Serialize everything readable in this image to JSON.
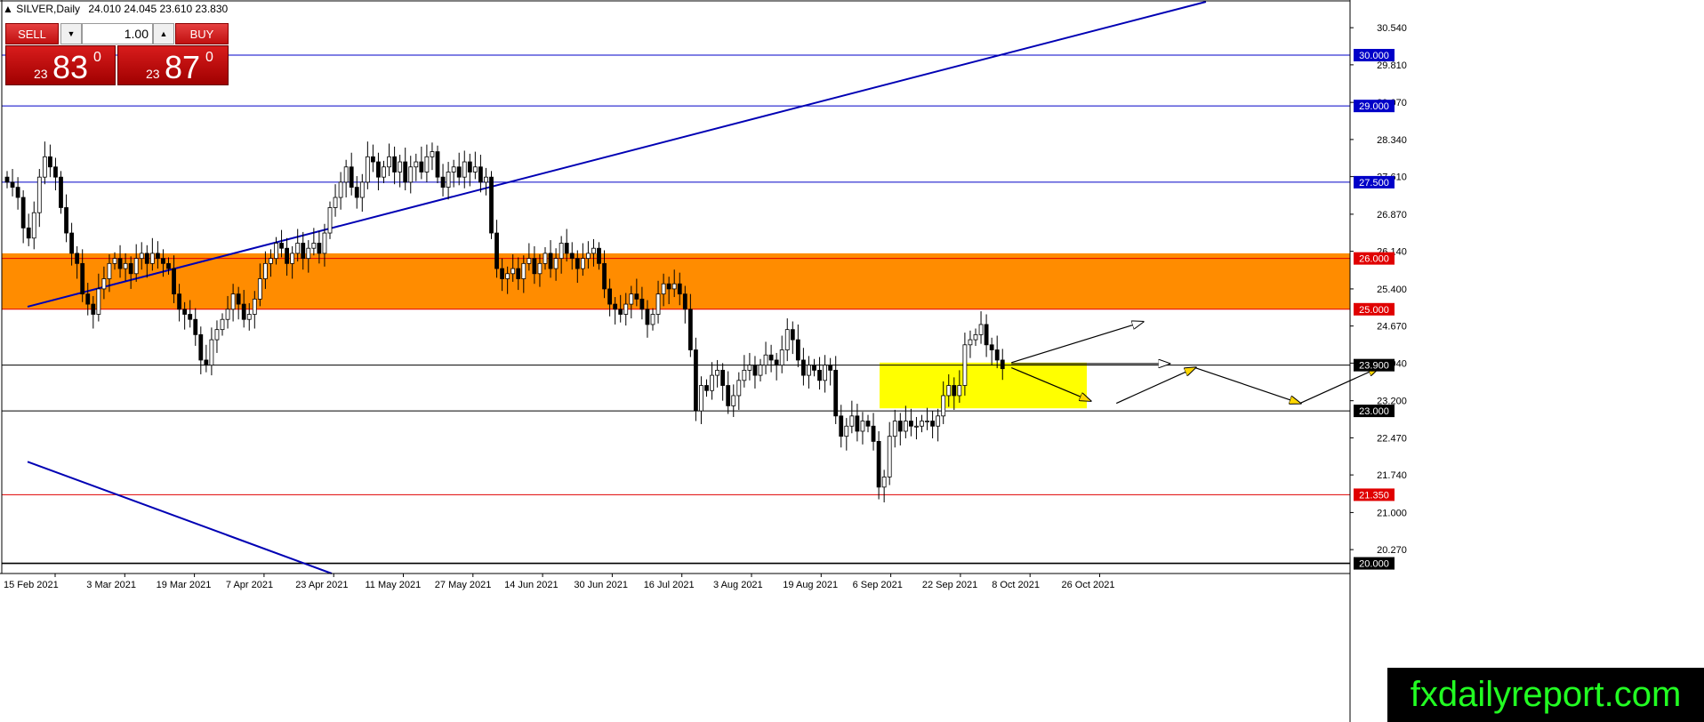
{
  "header": {
    "symbol": "SILVER,Daily",
    "ohlc": "24.010 24.045 23.610 23.830"
  },
  "trade_panel": {
    "sell_label": "SELL",
    "buy_label": "BUY",
    "lot_value": "1.00",
    "sell_price": {
      "prefix": "23",
      "big": "83",
      "sup": "0"
    },
    "buy_price": {
      "prefix": "23",
      "big": "87",
      "sup": "0"
    }
  },
  "watermark": "fxdailyreport.com",
  "colors": {
    "resistance_zone": "#ff8c00",
    "consolidation_zone": "#ffff00",
    "trendline": "#0000b4",
    "level_blue": "#0000c8",
    "level_red": "#e00000",
    "level_black": "#000000",
    "arrow_fill": "#ffd700",
    "watermark_bg": "#000000",
    "watermark_text": "#22ff22",
    "button_red": "#c81414"
  },
  "chart_data": {
    "type": "candlestick",
    "symbol": "SILVER",
    "timeframe": "Daily",
    "ylim": [
      19.8,
      31.05
    ],
    "price_ticks": [
      "30.540",
      "29.810",
      "29.070",
      "28.340",
      "27.610",
      "26.870",
      "26.140",
      "25.400",
      "24.670",
      "23.940",
      "23.200",
      "22.470",
      "21.740",
      "21.000",
      "20.270"
    ],
    "date_ticks": [
      "15 Feb 2021",
      "3 Mar 2021",
      "19 Mar 2021",
      "7 Apr 2021",
      "23 Apr 2021",
      "11 May 2021",
      "27 May 2021",
      "14 Jun 2021",
      "30 Jun 2021",
      "16 Jul 2021",
      "3 Aug 2021",
      "19 Aug 2021",
      "6 Sep 2021",
      "22 Sep 2021",
      "8 Oct 2021",
      "26 Oct 2021"
    ],
    "horizontal_levels": [
      {
        "price": 30.0,
        "label": "30.000",
        "color": "blue"
      },
      {
        "price": 29.0,
        "label": "29.000",
        "color": "blue"
      },
      {
        "price": 27.5,
        "label": "27.500",
        "color": "blue"
      },
      {
        "price": 26.0,
        "label": "26.000",
        "color": "red"
      },
      {
        "price": 25.0,
        "label": "25.000",
        "color": "red"
      },
      {
        "price": 23.9,
        "label": "23.900",
        "color": "black"
      },
      {
        "price": 23.0,
        "label": "23.000",
        "color": "black"
      },
      {
        "price": 21.35,
        "label": "21.350",
        "color": "red"
      },
      {
        "price": 20.0,
        "label": "20.000",
        "color": "black"
      }
    ],
    "zones": [
      {
        "name": "resistance",
        "from_date": "15 Feb 2021",
        "to_date": "open",
        "low": 25.0,
        "high": 26.1
      },
      {
        "name": "consolidation",
        "from_date": "3 Aug 2021",
        "to_date": "13 Sep 2021",
        "low": 23.05,
        "high": 23.95
      }
    ],
    "trendlines": [
      {
        "from": [
          "15 Feb 2021",
          25.05
        ],
        "to": [
          "3 Nov 2021",
          31.05
        ]
      },
      {
        "from": [
          "15 Feb 2021",
          22.0
        ],
        "to": [
          "23 Apr 2021",
          19.8
        ]
      }
    ],
    "projection_arrows": [
      {
        "from": [
          23.95,
          0
        ],
        "to": [
          24.75,
          5
        ],
        "fill": false
      },
      {
        "from": [
          23.93,
          0
        ],
        "to": [
          23.93,
          6
        ],
        "fill": false
      },
      {
        "from": [
          23.85,
          0
        ],
        "to": [
          23.2,
          3
        ],
        "fill": true
      },
      {
        "from": [
          23.15,
          4
        ],
        "to": [
          23.85,
          7
        ],
        "fill": true
      },
      {
        "from": [
          23.85,
          7
        ],
        "to": [
          23.15,
          11
        ],
        "fill": true
      },
      {
        "from": [
          23.15,
          11
        ],
        "to": [
          23.85,
          14
        ],
        "fill": true
      }
    ],
    "closes": [
      27.5,
      27.4,
      27.2,
      26.6,
      26.4,
      26.9,
      27.6,
      28.0,
      27.8,
      27.6,
      27.0,
      26.5,
      26.1,
      25.9,
      25.3,
      25.1,
      24.9,
      25.4,
      25.6,
      25.9,
      26.0,
      25.8,
      25.9,
      25.7,
      26.0,
      26.1,
      25.9,
      26.1,
      26.0,
      25.9,
      25.8,
      25.3,
      25.0,
      24.9,
      24.8,
      24.5,
      24.0,
      23.9,
      24.4,
      24.6,
      24.8,
      25.0,
      25.3,
      25.1,
      24.8,
      24.9,
      25.2,
      25.6,
      25.9,
      26.0,
      26.3,
      26.2,
      25.9,
      26.1,
      26.3,
      26.0,
      26.2,
      26.3,
      26.1,
      26.5,
      27.0,
      27.2,
      27.5,
      27.8,
      27.4,
      27.2,
      27.5,
      28.0,
      27.9,
      27.6,
      27.8,
      28.0,
      27.7,
      27.9,
      27.5,
      27.8,
      27.9,
      27.7,
      28.0,
      28.1,
      27.6,
      27.4,
      27.7,
      27.8,
      27.6,
      27.9,
      27.7,
      27.8,
      27.5,
      27.6,
      26.5,
      25.8,
      25.6,
      25.7,
      25.8,
      25.6,
      25.9,
      26.0,
      25.7,
      25.9,
      26.1,
      25.8,
      26.0,
      26.3,
      26.1,
      26.0,
      25.8,
      26.0,
      26.1,
      26.2,
      25.9,
      25.4,
      25.1,
      25.0,
      24.9,
      25.1,
      25.3,
      25.2,
      25.0,
      24.7,
      24.9,
      25.3,
      25.5,
      25.4,
      25.5,
      25.3,
      25.0,
      24.2,
      23.0,
      23.5,
      23.4,
      23.7,
      23.8,
      23.5,
      23.1,
      23.3,
      23.6,
      23.8,
      23.9,
      23.7,
      23.9,
      24.1,
      24.0,
      23.9,
      24.2,
      24.6,
      24.4,
      24.0,
      23.7,
      23.9,
      23.8,
      23.6,
      23.9,
      23.8,
      22.9,
      22.5,
      22.7,
      22.9,
      22.6,
      22.8,
      22.7,
      22.4,
      21.5,
      21.7,
      22.5,
      22.8,
      22.6,
      22.8,
      22.7,
      22.7,
      22.8,
      22.8,
      22.7,
      22.9,
      23.3,
      23.5,
      23.3,
      23.5,
      24.3,
      24.4,
      24.5,
      24.7,
      24.3,
      24.2,
      24.0,
      23.83
    ]
  }
}
